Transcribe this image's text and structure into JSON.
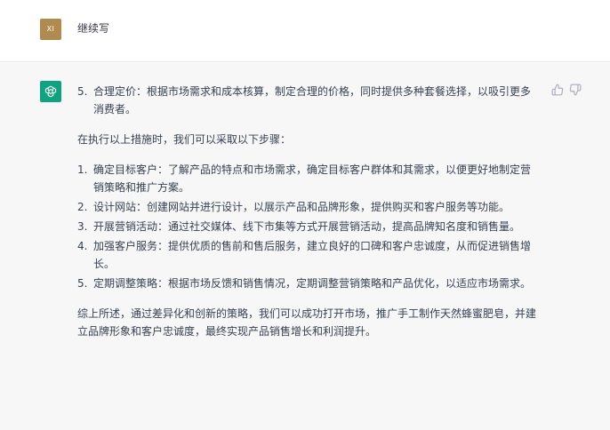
{
  "user": {
    "avatar_initials": "XI",
    "message": "继续写"
  },
  "assistant": {
    "first_item": {
      "number": "5.",
      "text": "合理定价：根据市场需求和成本核算，制定合理的价格，同时提供多种套餐选择，以吸引更多消费者。"
    },
    "intro": "在执行以上措施时，我们可以采取以下步骤：",
    "steps": [
      {
        "number": "1.",
        "text": "确定目标客户：了解产品的特点和市场需求，确定目标客户群体和其需求，以便更好地制定营销策略和推广方案。"
      },
      {
        "number": "2.",
        "text": "设计网站：创建网站并进行设计，以展示产品和品牌形象，提供购买和客户服务等功能。"
      },
      {
        "number": "3.",
        "text": "开展营销活动：通过社交媒体、线下市集等方式开展营销活动，提高品牌知名度和销售量。"
      },
      {
        "number": "4.",
        "text": "加强客户服务：提供优质的售前和售后服务，建立良好的口碑和客户忠诚度，从而促进销售增长。"
      },
      {
        "number": "5.",
        "text": "定期调整策略：根据市场反馈和销售情况，定期调整营销策略和产品优化，以适应市场需求。"
      }
    ],
    "summary": "综上所述，通过差异化和创新的策略，我们可以成功打开市场，推广手工制作天然蜂蜜肥皂，并建立品牌形象和客户忠诚度，最终实现产品销售增长和利润提升。"
  },
  "icons": {
    "assistant_avatar": "openai-logo-icon",
    "thumbs_up": "thumbs-up-icon",
    "thumbs_down": "thumbs-down-icon"
  },
  "colors": {
    "user_avatar_bg": "#b08a4f",
    "assistant_avatar_bg": "#10a37f",
    "assistant_bg": "#f7f7f8"
  }
}
